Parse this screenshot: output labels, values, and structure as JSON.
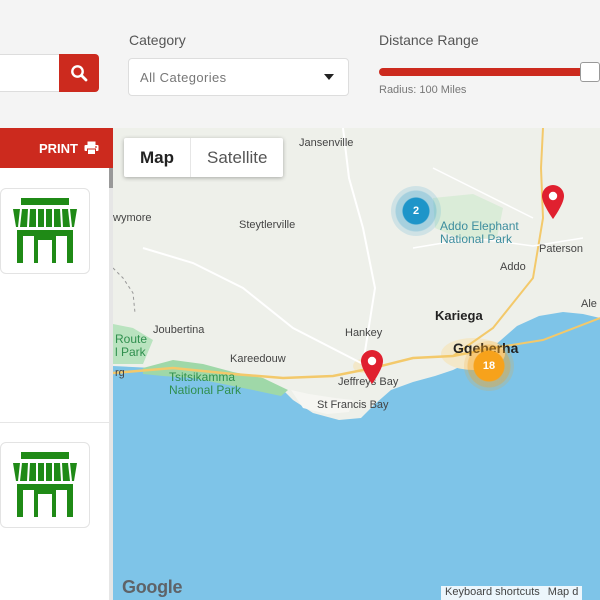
{
  "search": {
    "placeholder": "",
    "button_icon": "search-icon"
  },
  "filters": {
    "category_label": "Category",
    "category_value": "All Categories",
    "distance_label": "Distance Range",
    "slider_value_percent": 100,
    "radius_text": "Radius: 100  Miles"
  },
  "panel": {
    "print_label": "PRINT",
    "print_icon": "printer-icon",
    "card_icon": "storefront-icon",
    "card_color": "#1f8a16"
  },
  "map": {
    "type_map": "Map",
    "type_satellite": "Satellite",
    "places": {
      "jansenville": "Jansenville",
      "wymore": "wymore",
      "steytlerville": "Steytlerville",
      "addo_park_1": "Addo Elephant",
      "addo_park_2": "National Park",
      "paterson": "Paterson",
      "addo": "Addo",
      "ale": "Ale",
      "joubertina": "Joubertina",
      "route_1": "Route",
      "route_2": "l Park",
      "rg": "rg",
      "hankey": "Hankey",
      "kariega": "Kariega",
      "gqeberha": "Gqeberha",
      "kareedouw": "Kareedouw",
      "tsitsikamma_1": "Tsitsikamma",
      "tsitsikamma_2": "National Park",
      "jeffreys_bay": "Jeffreys Bay",
      "st_francis_bay": "St Francis Bay"
    },
    "clusters": {
      "blue_count": "2",
      "orange_count": "18"
    },
    "google_logo": "Google",
    "keyboard_shortcuts": "Keyboard shortcuts",
    "map_data": "Map d"
  },
  "colors": {
    "accent": "#cc2a1e",
    "water": "#7ec4e8",
    "pin": "#e0202f",
    "cluster_blue": "#1e95c9",
    "cluster_orange": "#f7a21b"
  }
}
